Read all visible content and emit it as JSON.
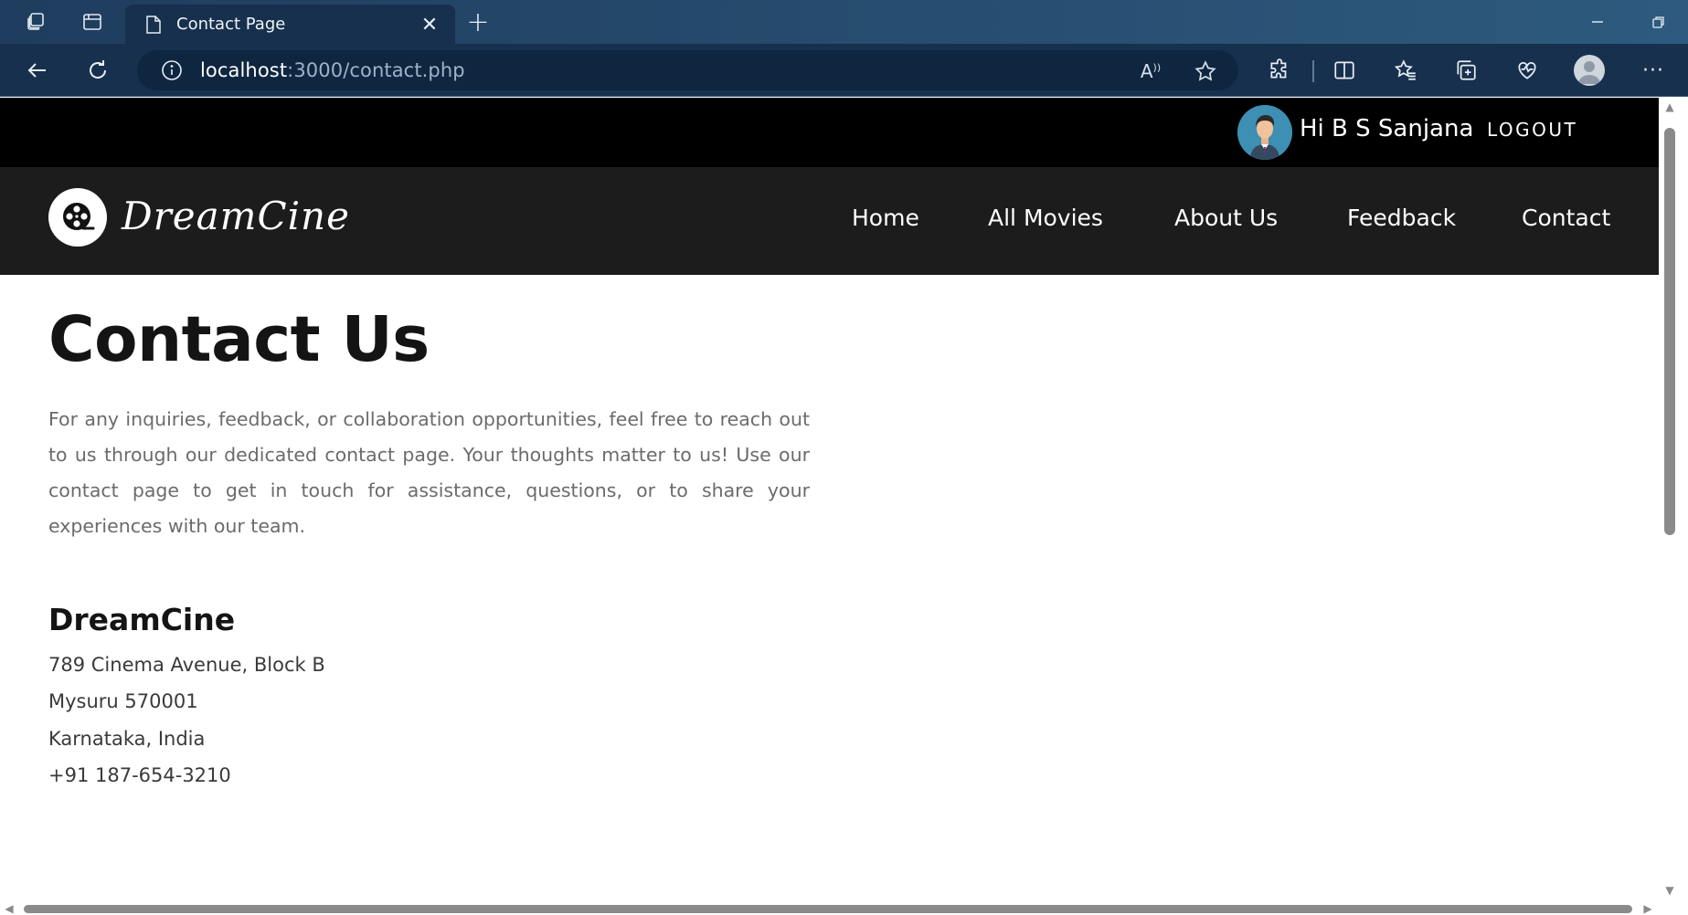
{
  "browser": {
    "tab_title": "Contact Page",
    "url_host": "localhost",
    "url_path": ":3000/contact.php"
  },
  "user_bar": {
    "greeting": "Hi B S Sanjana",
    "logout_label": "LOGOUT"
  },
  "nav": {
    "brand": "DreamCine",
    "items": [
      {
        "label": "Home"
      },
      {
        "label": "All Movies"
      },
      {
        "label": "About Us"
      },
      {
        "label": "Feedback"
      },
      {
        "label": "Contact"
      }
    ]
  },
  "main": {
    "title": "Contact Us",
    "description": "For any inquiries, feedback, or collaboration opportunities, feel free to reach out to us through our dedicated contact page. Your thoughts matter to us! Use our contact page to get in touch for assistance, questions, or to share your experiences with our team.",
    "company": "DreamCine",
    "address_lines": [
      "789 Cinema Avenue, Block B",
      "Mysuru 570001",
      "Karnataka, India",
      "+91 187-654-3210"
    ]
  }
}
